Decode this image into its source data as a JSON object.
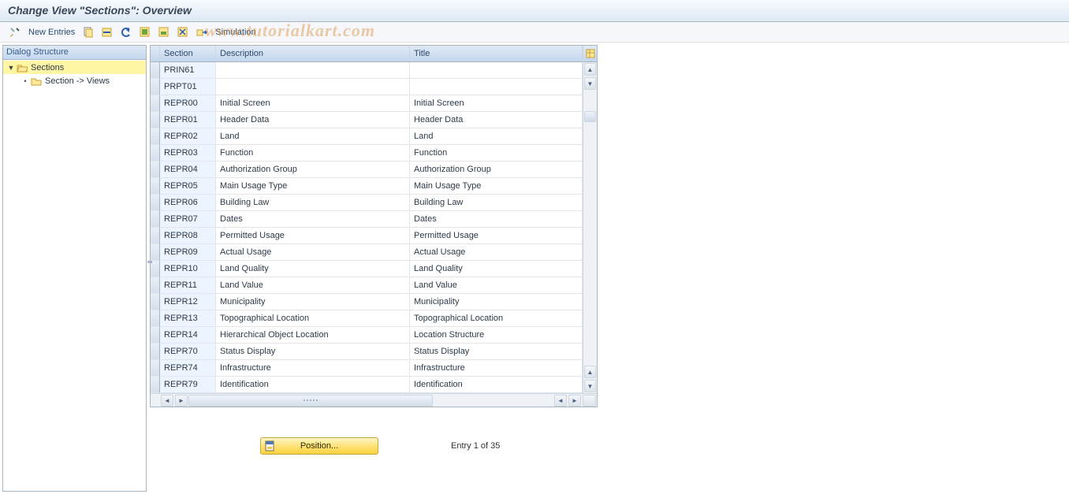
{
  "window_title": "Change View \"Sections\": Overview",
  "watermark": "www.tutorialkart.com",
  "toolbar": {
    "new_entries": "New Entries",
    "simulation": "Simulation"
  },
  "tree": {
    "header": "Dialog Structure",
    "nodes": [
      {
        "label": "Sections",
        "open": true,
        "selected": true,
        "level": 0,
        "expand": "▼"
      },
      {
        "label": "Section -> Views",
        "open": false,
        "selected": false,
        "level": 1,
        "expand": "•"
      }
    ]
  },
  "grid": {
    "columns": {
      "section": "Section",
      "description": "Description",
      "title": "Title"
    },
    "rows": [
      {
        "section": "PRIN61",
        "description": "",
        "title": ""
      },
      {
        "section": "PRPT01",
        "description": "",
        "title": ""
      },
      {
        "section": "REPR00",
        "description": "Initial Screen",
        "title": "Initial Screen"
      },
      {
        "section": "REPR01",
        "description": "Header Data",
        "title": "Header Data"
      },
      {
        "section": "REPR02",
        "description": "Land",
        "title": "Land"
      },
      {
        "section": "REPR03",
        "description": "Function",
        "title": "Function"
      },
      {
        "section": "REPR04",
        "description": "Authorization Group",
        "title": "Authorization Group"
      },
      {
        "section": "REPR05",
        "description": "Main Usage Type",
        "title": "Main Usage Type"
      },
      {
        "section": "REPR06",
        "description": "Building Law",
        "title": "Building Law"
      },
      {
        "section": "REPR07",
        "description": "Dates",
        "title": "Dates"
      },
      {
        "section": "REPR08",
        "description": "Permitted Usage",
        "title": "Permitted Usage"
      },
      {
        "section": "REPR09",
        "description": "Actual Usage",
        "title": "Actual Usage"
      },
      {
        "section": "REPR10",
        "description": "Land Quality",
        "title": "Land Quality"
      },
      {
        "section": "REPR11",
        "description": "Land Value",
        "title": "Land Value"
      },
      {
        "section": "REPR12",
        "description": "Municipality",
        "title": "Municipality"
      },
      {
        "section": "REPR13",
        "description": "Topographical Location",
        "title": "Topographical Location"
      },
      {
        "section": "REPR14",
        "description": "Hierarchical Object Location",
        "title": "Location Structure"
      },
      {
        "section": "REPR70",
        "description": "Status Display",
        "title": "Status Display"
      },
      {
        "section": "REPR74",
        "description": "Infrastructure",
        "title": "Infrastructure"
      },
      {
        "section": "REPR79",
        "description": "Identification",
        "title": "Identification"
      }
    ]
  },
  "footer": {
    "position_btn": "Position...",
    "entry_text": "Entry 1 of 35"
  }
}
